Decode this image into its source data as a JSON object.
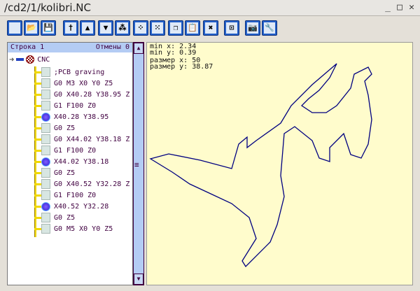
{
  "window": {
    "title": "/cd2/1/kolibri.NC"
  },
  "toolbar": {
    "buttons": [
      {
        "icon": "new-file-icon",
        "glyph": ""
      },
      {
        "icon": "open-folder-icon",
        "glyph": "📂"
      },
      {
        "icon": "save-icon",
        "glyph": "💾"
      },
      {
        "icon": "insert-line-icon",
        "glyph": "†"
      },
      {
        "icon": "move-up-icon",
        "glyph": "▲"
      },
      {
        "icon": "move-down-icon",
        "glyph": "▼"
      },
      {
        "icon": "points-icon",
        "glyph": "⁂"
      },
      {
        "icon": "points-up-icon",
        "glyph": "⁘"
      },
      {
        "icon": "points-down-icon",
        "glyph": "⁙"
      },
      {
        "icon": "copy-icon",
        "glyph": "❐"
      },
      {
        "icon": "paste-icon",
        "glyph": "📋"
      },
      {
        "icon": "delete-icon",
        "glyph": "✖"
      },
      {
        "icon": "fit-view-icon",
        "glyph": "⊡"
      },
      {
        "icon": "camera-icon",
        "glyph": "📷"
      },
      {
        "icon": "settings-wrench-icon",
        "glyph": "🔧"
      }
    ]
  },
  "panel": {
    "line_label": "Строка 1",
    "undo_label": "Отмены 0",
    "root": "CNC",
    "items": [
      {
        "text": ";PCB graving",
        "type": "doc"
      },
      {
        "text": "G0 M3 X0 Y0 Z5",
        "type": "doc"
      },
      {
        "text": "G0 X40.28 Y38.95 Z",
        "type": "doc"
      },
      {
        "text": "G1 F100 Z0",
        "type": "doc"
      },
      {
        "text": "X40.28 Y38.95",
        "type": "ball"
      },
      {
        "text": "G0 Z5",
        "type": "doc"
      },
      {
        "text": "G0 X44.02 Y38.18 Z",
        "type": "doc"
      },
      {
        "text": "G1 F100 Z0",
        "type": "doc"
      },
      {
        "text": "X44.02 Y38.18",
        "type": "ball"
      },
      {
        "text": "G0 Z5",
        "type": "doc"
      },
      {
        "text": "G0 X40.52 Y32.28 Z",
        "type": "doc"
      },
      {
        "text": "G1 F100 Z0",
        "type": "doc"
      },
      {
        "text": "X40.52 Y32.28",
        "type": "ball"
      },
      {
        "text": "G0 Z5",
        "type": "doc"
      },
      {
        "text": "G0 M5 X0 Y0 Z5",
        "type": "doc"
      }
    ]
  },
  "info": {
    "min_x": "min x: 2.34",
    "min_y": "min y: 0.39",
    "size_x": "размер x: 50",
    "size_y": "размер y: 38.87"
  },
  "colors": {
    "path": "#000080",
    "canvas": "#fffccc",
    "header": "#b4ccf4"
  }
}
